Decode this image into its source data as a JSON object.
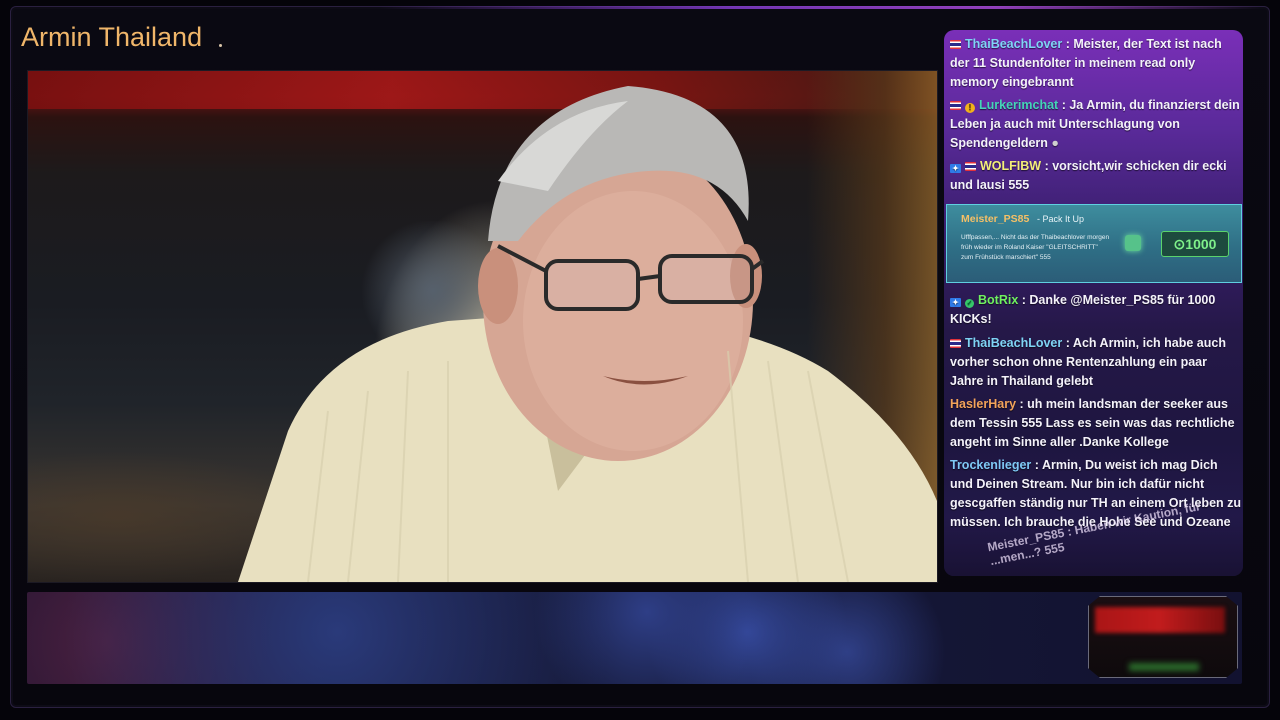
{
  "stream": {
    "channel_title": "Armin Thailand"
  },
  "chat": {
    "messages": [
      {
        "user": "ThaiBeachLover",
        "user_color": "#7fd4f5",
        "text": ": Meister, der Text ist nach der 11 Stundenfolter in meinem read only memory eingebrannt"
      },
      {
        "user": "Lurkerimchat",
        "user_color": "#45d4b8",
        "text": ": Ja Armin, du finanzierst dein Leben ja auch mit Unterschlagung von Spendengeldern"
      },
      {
        "user": "WOLFIBW",
        "user_color": "#f3ee7a",
        "text": ": vorsicht,wir schicken dir ecki und lausi 555"
      },
      {
        "user": "BotRix",
        "user_color": "#6ff060",
        "text": ": Danke @Meister_PS85 für 1000 KICKs!"
      },
      {
        "user": "ThaiBeachLover",
        "user_color": "#7fd4f5",
        "text": ": Ach Armin, ich habe auch vorher schon ohne Rentenzahlung ein paar Jahre in Thailand gelebt"
      },
      {
        "user": "HaslerHary",
        "user_color": "#f2a35a",
        "text": ": uh mein landsman der seeker aus dem Tessin 555 Lass es sein was das rechtliche angeht im Sinne aller .Danke Kollege"
      },
      {
        "user": "Trockenlieger",
        "user_color": "#7fc8f5",
        "text": ": Armin, Du weist ich mag Dich und Deinen Stream. Nur bin ich dafür nicht gescgaffen ständig nur TH an einem Ort leben zu müssen. Ich brauche die Hohe See und Ozeane"
      }
    ],
    "gift": {
      "user": "Meister_PS85",
      "tier": "- Pack It Up",
      "message": "Ufffpassen,... Nicht das der Thaibeachlover morgen früh wieder im Roland Kaiser \"GLEITSCHRITT\" zum Frühstück marschiert\" 555",
      "amount": "1000"
    },
    "incoming_message": "Meister_PS85 : Haben wir Kaution, für ...men...? 555"
  },
  "colors": {
    "title": "#f0b66a",
    "chat_top": "#7a2fb8",
    "chat_bottom": "#1e1640",
    "gift_border": "#5fd0e0",
    "gift_amount": "#7ff08a"
  }
}
